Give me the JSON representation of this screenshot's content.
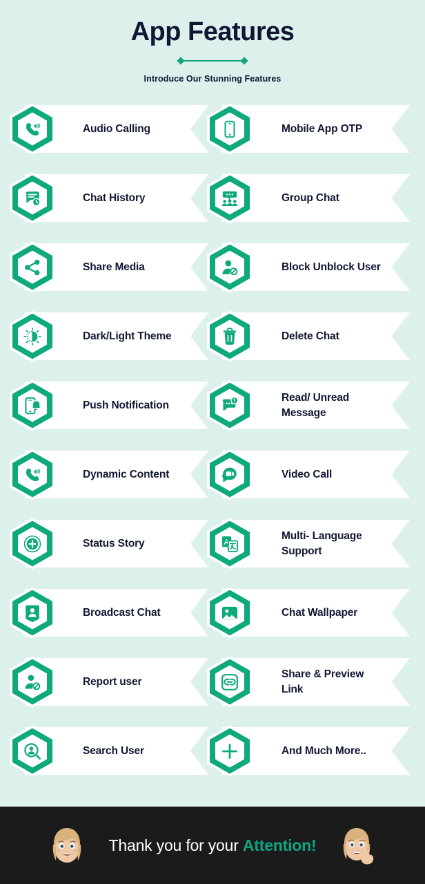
{
  "header": {
    "title": "App Features",
    "subtitle": "Introduce Our Stunning Features",
    "divider_icon": "diamond-line-diamond-divider"
  },
  "colors": {
    "background": "#dcf0ec",
    "accent_green": "#0ea97c",
    "card_surface": "#ffffff",
    "text_dark": "#111733",
    "footer_background": "#1b1b1b",
    "footer_accent": "#0fa583"
  },
  "features": {
    "rows": [
      {
        "left": {
          "label": "Audio Calling",
          "icon": "phone-speaker-icon"
        },
        "right": {
          "label": "Mobile App OTP",
          "icon": "mobile-phone-icon"
        }
      },
      {
        "left": {
          "label": "Chat History",
          "icon": "chat-bubble-clock-icon"
        },
        "right": {
          "label": "Group Chat",
          "icon": "group-people-chat-icon"
        }
      },
      {
        "left": {
          "label": "Share Media",
          "icon": "share-nodes-icon"
        },
        "right": {
          "label": "Block Unblock User",
          "icon": "user-blocked-icon"
        }
      },
      {
        "left": {
          "label": "Dark/Light Theme",
          "icon": "half-sun-icon"
        },
        "right": {
          "label": "Delete Chat",
          "icon": "trash-bin-icon"
        }
      },
      {
        "left": {
          "label": "Push Notification",
          "icon": "phone-bell-icon"
        },
        "right": {
          "label": "Read/ Unread\nMessage",
          "icon": "message-badge-icon"
        }
      },
      {
        "left": {
          "label": "Dynamic Content",
          "icon": "phone-speaker-icon"
        },
        "right": {
          "label": "Video Call",
          "icon": "video-bubble-icon"
        }
      },
      {
        "left": {
          "label": "Status Story",
          "icon": "circle-plus-ring-icon"
        },
        "right": {
          "label": "Multi- Language\nSupport",
          "icon": "translate-icon"
        }
      },
      {
        "left": {
          "label": "Broadcast Chat",
          "icon": "contact-card-icon"
        },
        "right": {
          "label": "Chat Wallpaper",
          "icon": "image-picture-icon"
        }
      },
      {
        "left": {
          "label": "Report user",
          "icon": "user-report-icon"
        },
        "right": {
          "label": "Share & Preview\nLink",
          "icon": "link-chain-icon"
        }
      },
      {
        "left": {
          "label": "Search User",
          "icon": "user-search-icon"
        },
        "right": {
          "label": "And Much More..",
          "icon": "plus-icon"
        }
      }
    ]
  },
  "footer": {
    "text_plain": "Thank you for your ",
    "text_accent": "Attention!",
    "avatar_left": "memoji-smiling-avatar",
    "avatar_right": "memoji-peace-sign-avatar"
  }
}
